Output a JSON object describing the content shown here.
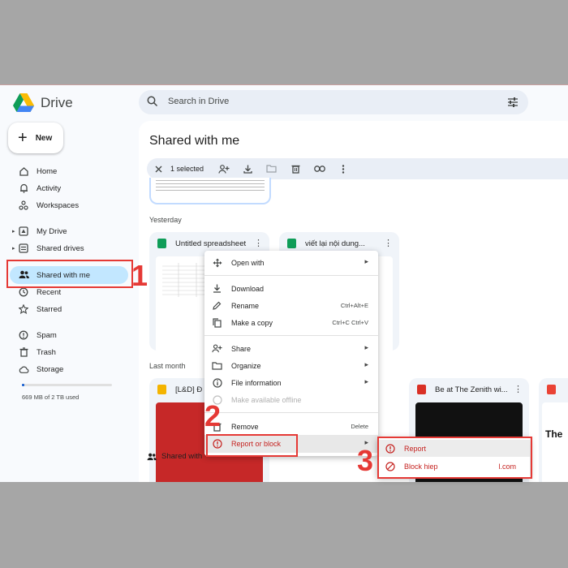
{
  "app": {
    "name": "Drive"
  },
  "search": {
    "placeholder": "Search in Drive"
  },
  "sidebar": {
    "new_label": "New",
    "items": [
      {
        "label": "Home",
        "icon": "home-icon"
      },
      {
        "label": "Activity",
        "icon": "bell-icon"
      },
      {
        "label": "Workspaces",
        "icon": "workspaces-icon"
      },
      {
        "label": "My Drive",
        "icon": "my-drive-icon"
      },
      {
        "label": "Shared drives",
        "icon": "shared-drives-icon"
      },
      {
        "label": "Shared with me",
        "icon": "people-icon",
        "active": true
      },
      {
        "label": "Recent",
        "icon": "clock-icon"
      },
      {
        "label": "Starred",
        "icon": "star-icon"
      },
      {
        "label": "Spam",
        "icon": "spam-icon"
      },
      {
        "label": "Trash",
        "icon": "trash-icon"
      },
      {
        "label": "Storage",
        "icon": "cloud-icon"
      }
    ],
    "storage_used_fraction": 0.03,
    "storage_text": "669 MB of 2 TB used"
  },
  "main": {
    "title": "Shared with me",
    "selection": {
      "count_text": "1 selected"
    },
    "sections": {
      "yesterday": "Yesterday",
      "last_month": "Last month"
    },
    "cards_yesterday": [
      {
        "name": "Untitled spreadsheet",
        "icon": "sheets-icon"
      },
      {
        "name": "viết lại nội dung...",
        "icon": "sheets-icon"
      }
    ],
    "cards_last_month": [
      {
        "name": "[L&D] Đ",
        "icon": "slides-icon"
      },
      {
        "name": "Be at The Zenith wi...",
        "icon": "video-icon"
      },
      {
        "name": "The",
        "icon": "pdf-icon"
      }
    ],
    "shared_tab": "Shared with"
  },
  "context_menu": {
    "items": [
      {
        "label": "Open with",
        "has_submenu": true
      },
      {
        "label": "Download"
      },
      {
        "label": "Rename",
        "shortcut": "Ctrl+Alt+E"
      },
      {
        "label": "Make a copy",
        "shortcut": "Ctrl+C Ctrl+V"
      },
      {
        "label": "Share",
        "has_submenu": true
      },
      {
        "label": "Organize",
        "has_submenu": true
      },
      {
        "label": "File information",
        "has_submenu": true
      },
      {
        "label": "Make available offline",
        "disabled": true
      },
      {
        "label": "Remove",
        "shortcut": "Delete"
      },
      {
        "label": "Report or block",
        "has_submenu": true,
        "highlighted": true
      }
    ]
  },
  "submenu": {
    "items": [
      {
        "label": "Report"
      },
      {
        "label": "Block hiep                              l.com"
      }
    ]
  },
  "annotations": [
    "1",
    "2",
    "3"
  ],
  "colors": {
    "accent": "#0b57d0",
    "active_bg": "#c2e7ff",
    "annotation": "#e53935",
    "danger": "#c5221f"
  }
}
